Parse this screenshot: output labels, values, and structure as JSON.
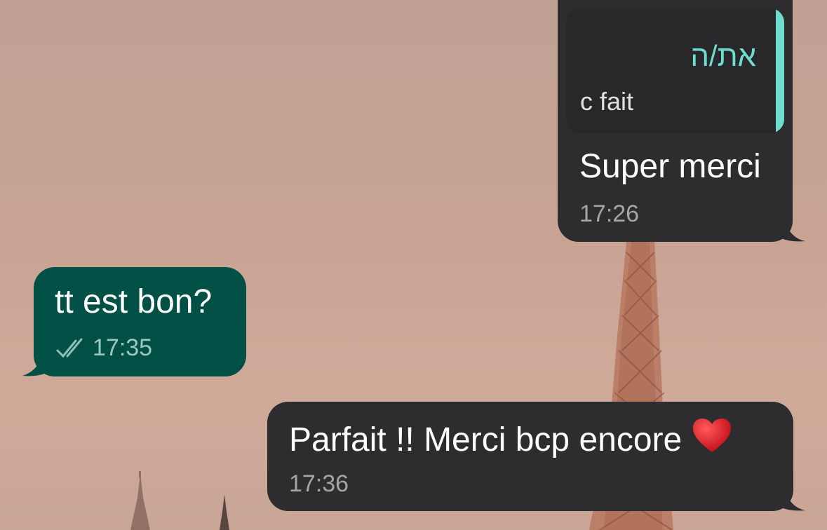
{
  "messages": [
    {
      "id": "m1",
      "side": "incoming",
      "reply": {
        "author": "את/ה",
        "text": "c fait"
      },
      "text": "Super merci",
      "time": "17:26"
    },
    {
      "id": "m2",
      "side": "outgoing",
      "text": "tt est bon?",
      "time": "17:35",
      "status_icon": "double-check-icon"
    },
    {
      "id": "m3",
      "side": "incoming",
      "text": "Parfait !! Merci bcp encore",
      "emoji": "red-heart-icon",
      "time": "17:36"
    }
  ],
  "colors": {
    "incoming_bubble": "#2d2d2f",
    "outgoing_bubble": "#005046",
    "reply_accent": "#6fdcd0",
    "timestamp": "#a5a5a7"
  },
  "wallpaper": "paris-eiffel-tower-wallpaper"
}
